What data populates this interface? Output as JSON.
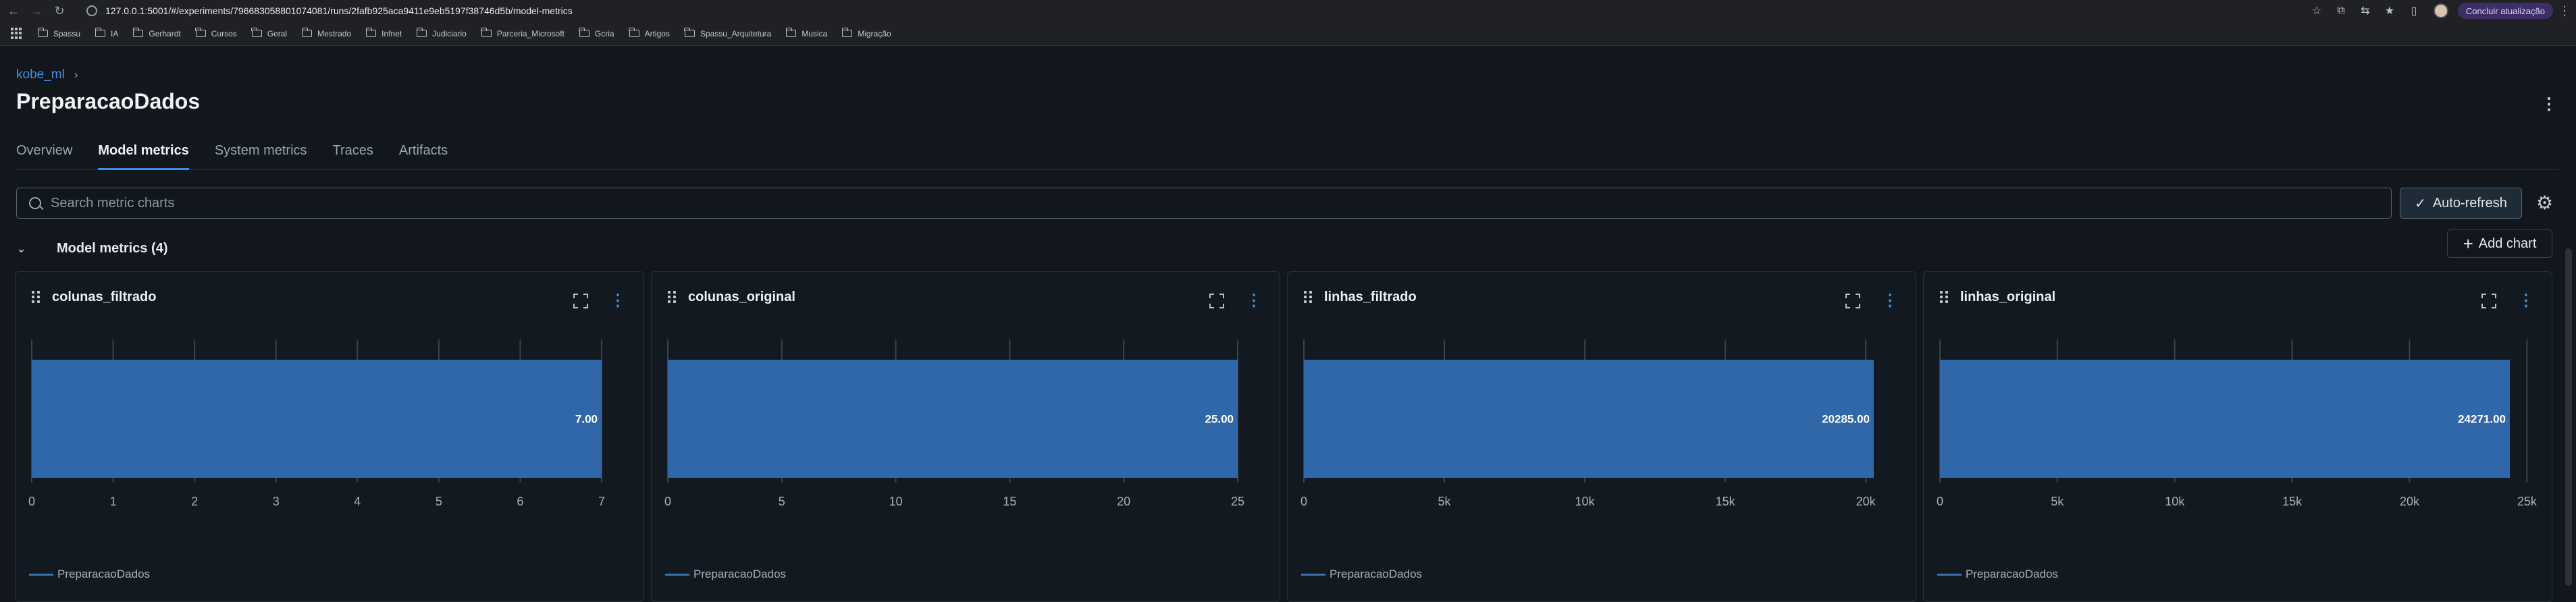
{
  "browser": {
    "url": "127.0.0.1:5001/#/experiments/796683058801074081/runs/2fafb925aca9411e9eb5197f38746d5b/model-metrics",
    "update_button": "Concluir atualização",
    "bookmarks": [
      "Spassu",
      "IA",
      "Gerhardt",
      "Cursos",
      "Geral",
      "Mestrado",
      "Infnet",
      "Judiciario",
      "Parceria_Microsoft",
      "Gcria",
      "Artigos",
      "Spassu_Arquitetura",
      "Musica",
      "Migração"
    ]
  },
  "breadcrumb": {
    "parent": "kobe_ml",
    "separator": "›"
  },
  "page": {
    "title": "PreparacaoDados"
  },
  "tabs": [
    "Overview",
    "Model metrics",
    "System metrics",
    "Traces",
    "Artifacts"
  ],
  "active_tab": "Model metrics",
  "search": {
    "placeholder": "Search metric charts",
    "value": ""
  },
  "toolbar": {
    "auto_refresh": "Auto-refresh",
    "add_chart": "Add chart"
  },
  "section": {
    "title": "Model metrics (4)"
  },
  "colors": {
    "bar": "#2f67a8",
    "accent": "#3d8ee0",
    "background": "#11171c"
  },
  "chart_data": [
    {
      "type": "bar",
      "title": "colunas_filtrado",
      "orientation": "horizontal",
      "series": [
        {
          "name": "PreparacaoDados",
          "values": [
            7
          ]
        }
      ],
      "value_label": "7.00",
      "xlim": [
        0,
        7
      ],
      "xticks": [
        "0",
        "1",
        "2",
        "3",
        "4",
        "5",
        "6",
        "7"
      ],
      "xtick_values": [
        0,
        1,
        2,
        3,
        4,
        5,
        6,
        7
      ]
    },
    {
      "type": "bar",
      "title": "colunas_original",
      "orientation": "horizontal",
      "series": [
        {
          "name": "PreparacaoDados",
          "values": [
            25
          ]
        }
      ],
      "value_label": "25.00",
      "xlim": [
        0,
        25
      ],
      "xticks": [
        "0",
        "5",
        "10",
        "15",
        "20",
        "25"
      ],
      "xtick_values": [
        0,
        5,
        10,
        15,
        20,
        25
      ]
    },
    {
      "type": "bar",
      "title": "linhas_filtrado",
      "orientation": "horizontal",
      "series": [
        {
          "name": "PreparacaoDados",
          "values": [
            20285
          ]
        }
      ],
      "value_label": "20285.00",
      "xlim": [
        0,
        20285
      ],
      "xticks": [
        "0",
        "5k",
        "10k",
        "15k",
        "20k"
      ],
      "xtick_values": [
        0,
        5000,
        10000,
        15000,
        20000
      ]
    },
    {
      "type": "bar",
      "title": "linhas_original",
      "orientation": "horizontal",
      "series": [
        {
          "name": "PreparacaoDados",
          "values": [
            24271
          ]
        }
      ],
      "value_label": "24271.00",
      "xlim": [
        0,
        24271
      ],
      "xticks": [
        "0",
        "5k",
        "10k",
        "15k",
        "20k",
        "25k"
      ],
      "xtick_values": [
        0,
        5000,
        10000,
        15000,
        20000,
        25000
      ]
    }
  ]
}
